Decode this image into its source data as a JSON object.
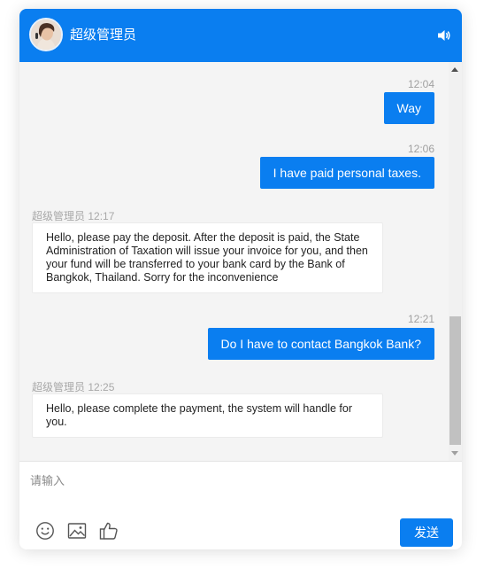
{
  "header": {
    "title": "超级管理员",
    "accent_color": "#0a7ef0",
    "avatar": "agent-avatar",
    "sound_icon": "speaker-icon"
  },
  "messages": [
    {
      "side": "right",
      "time": "12:04",
      "text": "Way"
    },
    {
      "side": "right",
      "time": "12:06",
      "text": "I have paid personal taxes."
    },
    {
      "side": "left",
      "sender": "超级管理员",
      "time": "12:17",
      "text": "Hello, please pay the deposit. After the deposit is paid, the State Administration of Taxation will issue your invoice for you, and then your fund will be transferred to your bank card by the Bank of Bangkok, Thailand. Sorry for the inconvenience"
    },
    {
      "side": "right",
      "time": "12:21",
      "text": "Do I have to contact Bangkok Bank?"
    },
    {
      "side": "left",
      "sender": "超级管理员",
      "time": "12:25",
      "text": "Hello, please complete the payment, the system will handle for you."
    }
  ],
  "composer": {
    "placeholder": "请输入",
    "value": "",
    "tools": [
      "emoji-icon",
      "image-icon",
      "thumbs-up-icon"
    ],
    "send_label": "发送"
  }
}
